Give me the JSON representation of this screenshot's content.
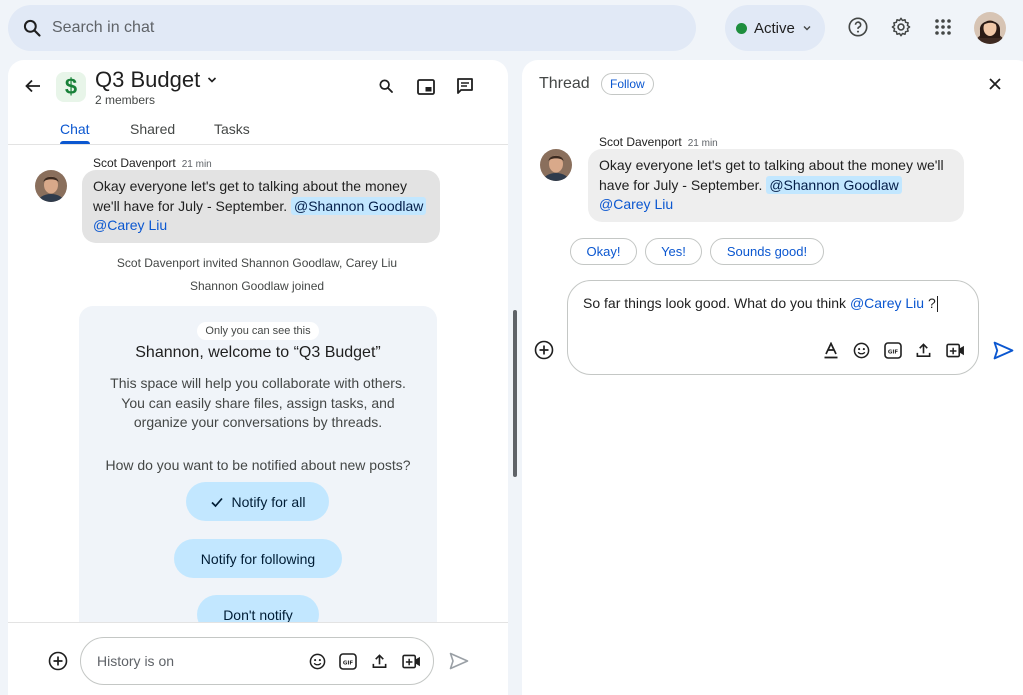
{
  "search": {
    "placeholder": "Search in chat"
  },
  "status": {
    "label": "Active",
    "color": "#1e8e3e"
  },
  "icons": {
    "help": "help-icon",
    "settings": "gear-icon",
    "apps": "apps-grid-icon"
  },
  "space": {
    "title": "Q3 Budget",
    "icon": "$",
    "members": "2 members",
    "tabs": [
      "Chat",
      "Shared",
      "Tasks"
    ]
  },
  "message": {
    "author": "Scot Davenport",
    "time": "21 min",
    "text_line1": "Okay everyone let's get to talking about the money",
    "text_line2": "we'll have  for July - September.",
    "mention1": "@Shannon Goodlaw",
    "mention2": "@Carey Liu"
  },
  "system": {
    "invited": "Scot Davenport invited Shannon Goodlaw, Carey Liu",
    "joined": "Shannon Goodlaw joined"
  },
  "welcome": {
    "badge": "Only you can see this",
    "title": "Shannon, welcome to “Q3 Budget”",
    "body1": "This space will help you collaborate with others.",
    "body2": "You can easily share files, assign tasks, and",
    "body3": "organize your conversations by threads.",
    "question": "How do you want to be notified about new posts?",
    "options": [
      "Notify for all",
      "Notify for following",
      "Don't notify"
    ]
  },
  "composer": {
    "placeholder": "History is on"
  },
  "thread": {
    "title": "Thread",
    "follow": "Follow",
    "text_line1": "Okay everyone let's get to talking about the money we'll",
    "text_line2": "have  for July - September.",
    "smart_replies": [
      "Okay!",
      "Yes!",
      "Sounds good!"
    ],
    "reply_text": "So far things look good. What do you think",
    "reply_mention": "@Carey Liu",
    "reply_tail": "?"
  }
}
